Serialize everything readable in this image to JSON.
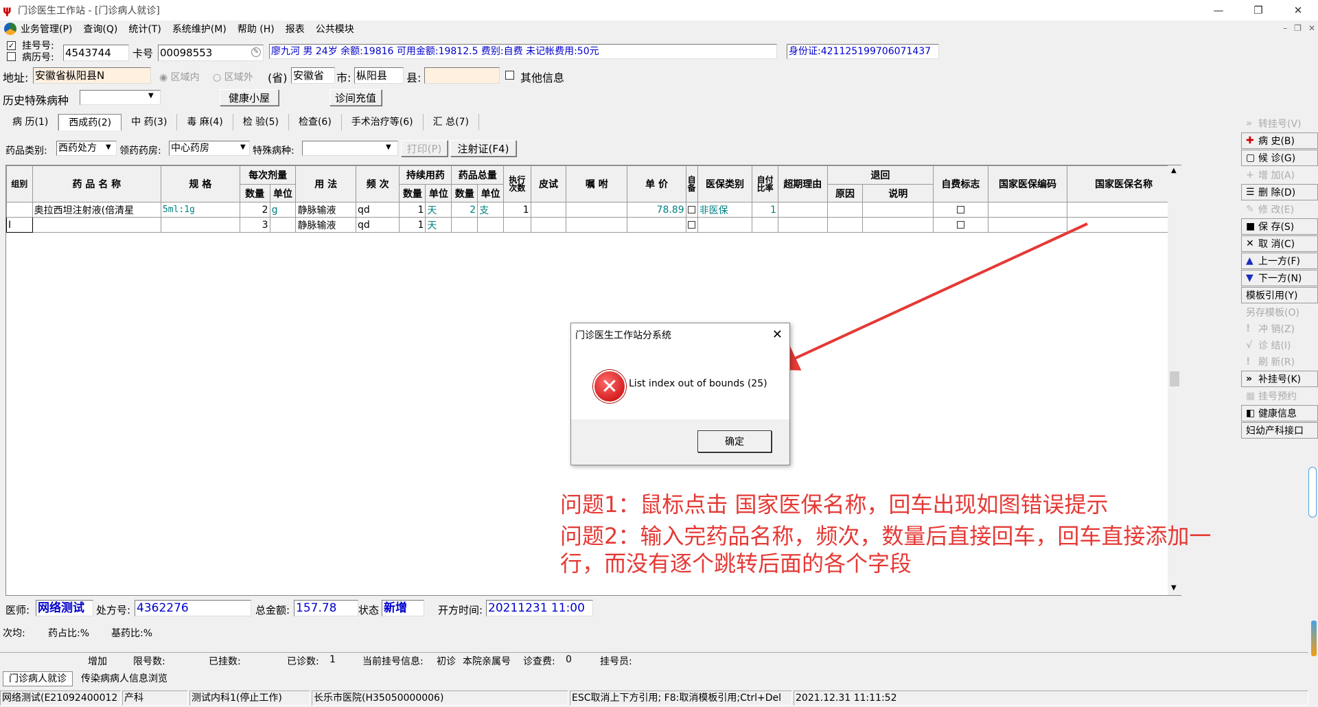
{
  "window": {
    "title": "门诊医生工作站 - [门诊病人就诊]",
    "controls": [
      "—",
      "❐",
      "✕"
    ],
    "mdi_controls": [
      "–",
      "❐",
      "✕"
    ]
  },
  "menu": [
    "业务管理(P)",
    "查询(Q)",
    "统计(T)",
    "系统维护(M)",
    "帮助 (H)",
    "报表",
    "公共模块"
  ],
  "patient": {
    "reg_no_label": "挂号号:",
    "record_no_label": "病历号:",
    "reg_no": "4543744",
    "card_label": "卡号",
    "card_no": "00098553",
    "info": "廖九河  男  24岁  余额:19816  可用金额:19812.5  费别:自费  未记帐费用:50元",
    "id_card": "身份证:421125199706071437",
    "address_label": "地址:",
    "address": "安徽省枞阳县N",
    "area_in": "区域内",
    "area_out": "区域外",
    "province_label": "(省)",
    "province": "安徽省",
    "city_label": "市:",
    "city": "枞阳县",
    "county_label": "县:",
    "other_info": "其他信息",
    "history_label": "历史特殊病种",
    "health_btn": "健康小屋",
    "recharge_btn": "诊间充值"
  },
  "tabs": [
    "病 历(1)",
    "西成药(2)",
    "中 药(3)",
    "毒 麻(4)",
    "检 验(5)",
    "检查(6)",
    "手术治疗等(6)",
    "汇 总(7)"
  ],
  "filters": {
    "drug_type_label": "药品类别:",
    "drug_type": "西药处方",
    "pharmacy_label": "领药药房:",
    "pharmacy": "中心药房",
    "disease_label": "特殊病种:",
    "print_btn": "打印(P)",
    "inject_btn": "注射证(F4)"
  },
  "grid": {
    "headers": {
      "group": "组别",
      "name": "药 品 名 称",
      "spec": "规 格",
      "dose": "每次剂量",
      "dose_qty": "数量",
      "dose_unit": "单位",
      "usage": "用 法",
      "freq": "频 次",
      "cont": "持续用药",
      "cont_qty": "数量",
      "cont_unit": "单位",
      "total": "药品总量",
      "total_qty": "数量",
      "total_unit": "单位",
      "exec": "执行次数",
      "skin": "皮试",
      "advice": "嘱 咐",
      "price": "单 价",
      "self": "自备",
      "ins_type": "医保类别",
      "ratio": "自付比率",
      "over": "超期理由",
      "ret": "退回",
      "ret_reason": "原因",
      "ret_note": "说明",
      "self_flag": "自费标志",
      "nat_code": "国家医保编码",
      "nat_name": "国家医保名称"
    },
    "rows": [
      {
        "group": "",
        "name": "奥拉西坦注射液(倍清星",
        "spec": "5ml:1g",
        "dose_qty": "2",
        "dose_unit": "g",
        "usage": "静脉输液",
        "freq": "qd",
        "cont_qty": "1",
        "cont_unit": "天",
        "total_qty": "2",
        "total_unit": "支",
        "exec": "1",
        "price": "78.89",
        "ins_type": "非医保",
        "ratio": "1"
      },
      {
        "group": "I",
        "name": "",
        "spec": "",
        "dose_qty": "3",
        "dose_unit": "",
        "usage": "静脉输液",
        "freq": "qd",
        "cont_qty": "1",
        "cont_unit": "天",
        "total_qty": "",
        "total_unit": "",
        "exec": "",
        "price": "",
        "ins_type": "",
        "ratio": ""
      }
    ]
  },
  "right_buttons": [
    {
      "icon": "double-chevron-icon",
      "label": "转挂号(V)",
      "enabled": false
    },
    {
      "icon": "plus-icon",
      "label": "病  史(B)",
      "enabled": true
    },
    {
      "icon": "page-icon",
      "label": "候  诊(G)",
      "enabled": true
    },
    {
      "icon": "add-icon",
      "label": "增  加(A)",
      "enabled": false
    },
    {
      "icon": "delete-icon",
      "label": "删  除(D)",
      "enabled": true
    },
    {
      "icon": "edit-icon",
      "label": "修  改(E)",
      "enabled": false
    },
    {
      "icon": "save-icon",
      "label": "保  存(S)",
      "enabled": true
    },
    {
      "icon": "cancel-icon",
      "label": "取  消(C)",
      "enabled": true
    },
    {
      "icon": "up-icon",
      "label": "上一方(F)",
      "enabled": true
    },
    {
      "icon": "down-icon",
      "label": "下一方(N)",
      "enabled": true
    },
    {
      "icon": "",
      "label": "模板引用(Y)",
      "enabled": true
    },
    {
      "icon": "",
      "label": "另存模板(O)",
      "enabled": false
    },
    {
      "icon": "reverse-icon",
      "label": "冲  销(Z)",
      "enabled": false
    },
    {
      "icon": "check-icon",
      "label": "诊  结(I)",
      "enabled": false
    },
    {
      "icon": "refresh-icon",
      "label": "刷  新(R)",
      "enabled": false
    },
    {
      "icon": "double-chevron-icon",
      "label": "补挂号(K)",
      "enabled": true
    },
    {
      "icon": "calendar-icon",
      "label": "挂号预约",
      "enabled": false
    },
    {
      "icon": "health-icon",
      "label": "健康信息",
      "enabled": true
    },
    {
      "icon": "",
      "label": "妇幼产科接口",
      "enabled": true
    }
  ],
  "dialog": {
    "title": "门诊医生工作站分系统",
    "message": "List index out of bounds (25)",
    "ok": "确定",
    "close": "✕"
  },
  "annotations": [
    "问题1：鼠标点击 国家医保名称，回车出现如图错误提示",
    "问题2：输入完药品名称，频次，数量后直接回车，回车直接添加一",
    "行，而没有逐个跳转后面的各个字段"
  ],
  "footer": {
    "doctor_label": "医师:",
    "doctor": "网络测试",
    "rx_label": "处方号:",
    "rx_no": "4362276",
    "total_label": "总金额:",
    "total": "157.78",
    "state_label": "状态",
    "state": "新增",
    "time_label": "开方时间:",
    "time": "20211231 11:00",
    "avg_label": "次均:",
    "drug_ratio": "药占比:%",
    "base_ratio": "基药比:%",
    "stat": [
      "增加",
      "限号数:",
      "",
      "已挂数:",
      "",
      "已诊数:",
      "1",
      "当前挂号信息:",
      "初诊",
      "本院亲属号",
      "诊查费:",
      "0",
      "挂号员:"
    ],
    "bottom_tabs": [
      "门诊病人就诊",
      "传染病病人信息浏览"
    ],
    "status": [
      "网络测试(E21092400012",
      "产科",
      "测试内科1(停止工作)",
      "长乐市医院(H35050000006)",
      "ESC取消上下方引用; F8:取消模板引用;Ctrl+Del",
      "2021.12.31 11:11:52"
    ]
  },
  "colors": {
    "accent_teal": "#008080",
    "note_red": "#e53935",
    "info_blue": "#0000cc"
  }
}
